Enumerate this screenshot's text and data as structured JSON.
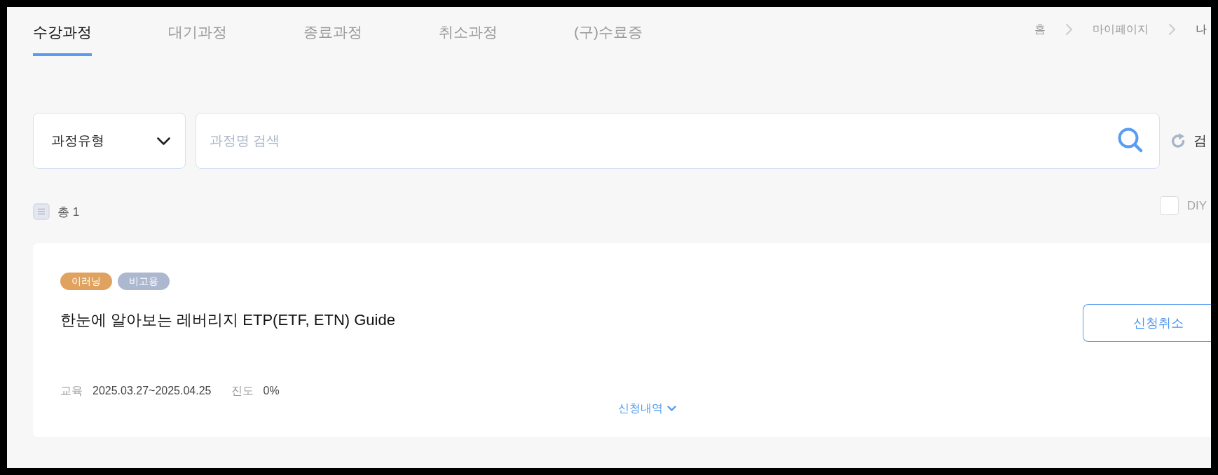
{
  "tabs": [
    {
      "label": "수강과정",
      "selected": true
    },
    {
      "label": "대기과정",
      "selected": false
    },
    {
      "label": "종료과정",
      "selected": false
    },
    {
      "label": "취소과정",
      "selected": false
    },
    {
      "label": "(구)수료증",
      "selected": false
    }
  ],
  "breadcrumb": [
    {
      "label": "홈",
      "current": false
    },
    {
      "label": "마이페이지",
      "current": false
    },
    {
      "label": "나",
      "current": true
    }
  ],
  "filters": {
    "course_type": "과정유형",
    "search": {
      "placeholder": "과정명 검색"
    },
    "reset_button": "검"
  },
  "summary": {
    "total": "총 1",
    "diy_filter": {
      "label": "DIY",
      "checked": false
    }
  },
  "courses": [
    {
      "tags": [
        {
          "label": "이러닝",
          "color": "#e0a35f"
        },
        {
          "label": "비고용",
          "color": "#acb8d0"
        }
      ],
      "title": "한눈에 알아보는 레버리지 ETP(ETF, ETN) Guide",
      "education_label": "교육",
      "education_period": "2025.03.27~2025.04.25",
      "progress_label": "진도",
      "progress": "0%",
      "cancel_button": "신청취소",
      "history_link": "신청내역"
    }
  ]
}
